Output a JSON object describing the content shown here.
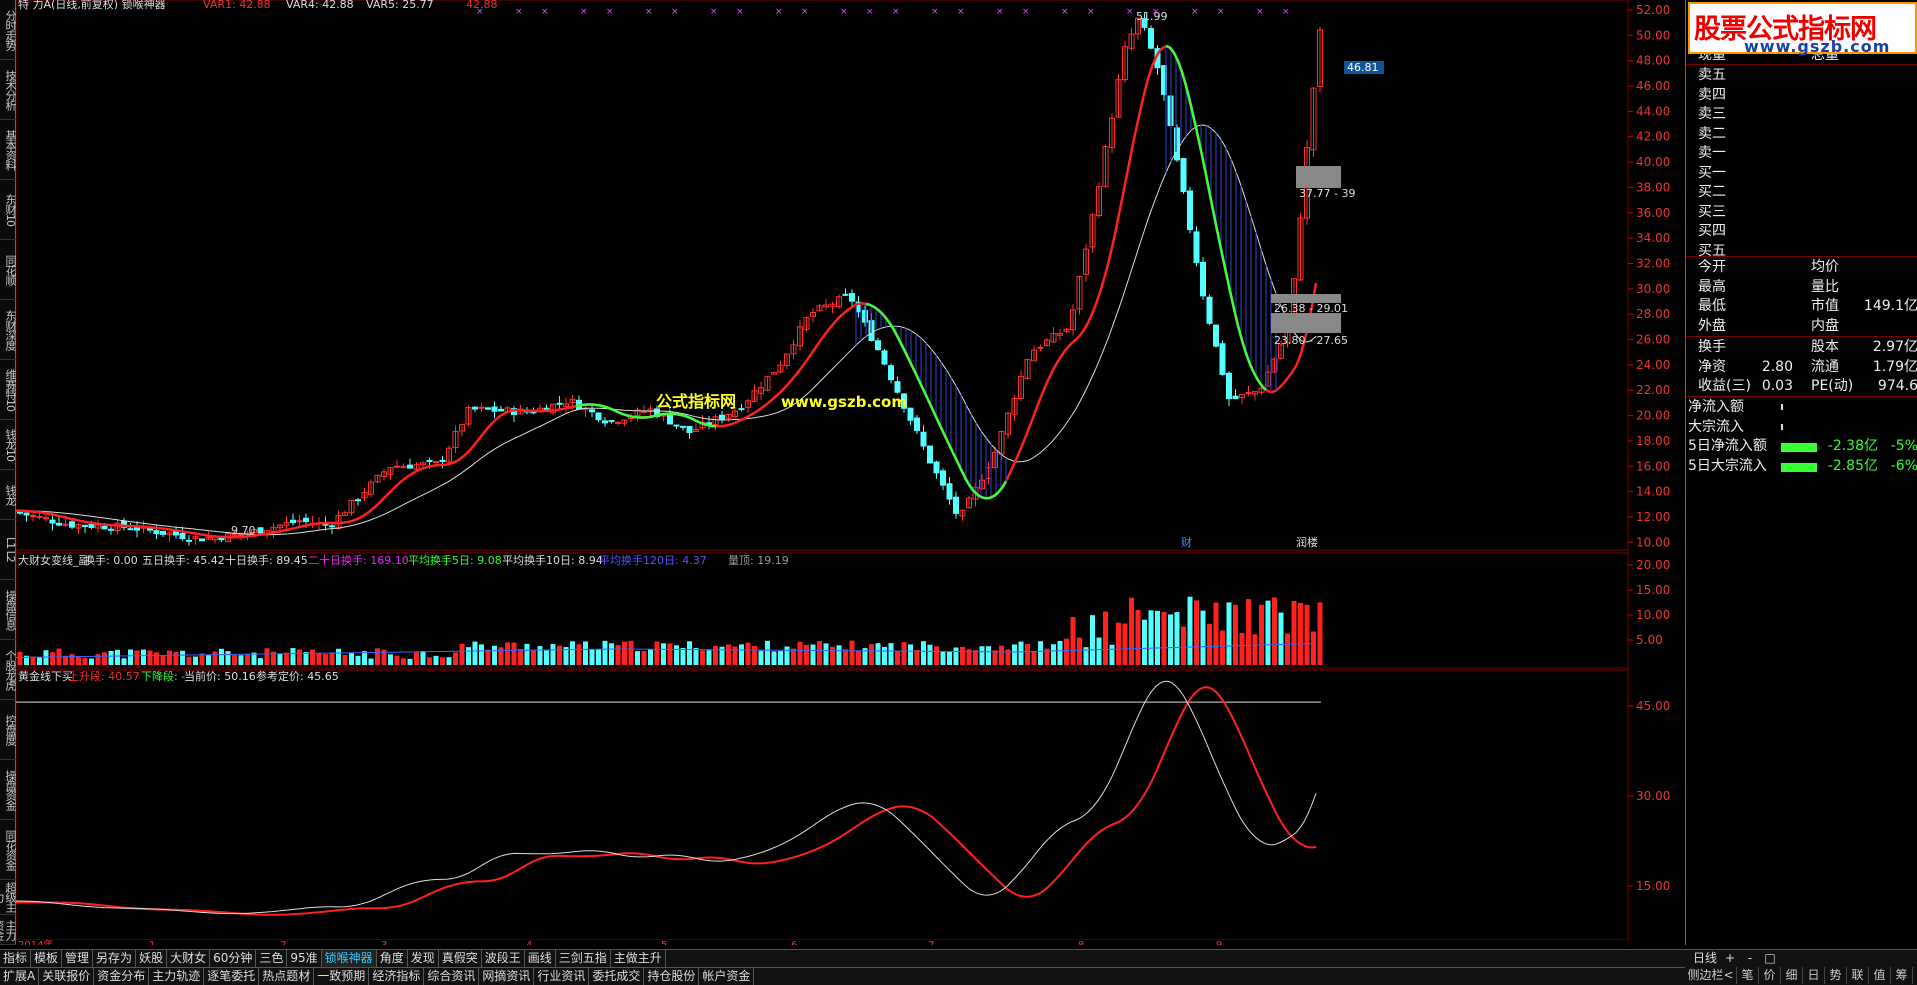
{
  "sidebar": {
    "tabs": [
      "分时走势",
      "技术分析",
      "基本资料",
      "东财10",
      "同花顺",
      "东财深度",
      "维赛特10",
      "钱龙10",
      "钱龙",
      "L1 L2",
      "操盘信息",
      "个股龙虎",
      "控盘度",
      "操盘资金",
      "同花资金",
      "超级主力",
      "主力资金"
    ]
  },
  "header": {
    "title": "特 力A(日线,前复权) 锁喉神器",
    "var1": "VAR1: 42.88",
    "var4": "VAR4: 42.88",
    "var5": "VAR5: 25.77",
    "var6": "42.88"
  },
  "price_labels": {
    "high": "51.99",
    "low": "9.70",
    "ref": "46.81",
    "box1": "37.77 - 39",
    "box2": "26.38 - 29.01",
    "box3": "23.80 - 27.65",
    "badge1": "财",
    "badge2": "润楼"
  },
  "price_axis": [
    "52.00",
    "50.00",
    "48.00",
    "46.00",
    "44.00",
    "42.00",
    "40.00",
    "38.00",
    "36.00",
    "34.00",
    "32.00",
    "30.00",
    "28.00",
    "26.00",
    "24.00",
    "22.00",
    "20.00",
    "18.00",
    "16.00",
    "14.00",
    "12.00",
    "10.00"
  ],
  "watermark": {
    "cn": "公式指标网",
    "url": "www.gszb.com"
  },
  "vol_header": {
    "name": "大财女变线_副",
    "f1": "换手: 0.00",
    "f2": "五日换手: 45.42",
    "f3": "十日换手: 89.45",
    "f4": "二十日换手: 169.10",
    "f5": "平均换手5日: 9.08",
    "f6": "平均换手10日: 8.94",
    "f7": "平均换手120日: 4.37",
    "f8": "量顶: 19.19"
  },
  "vol_axis": [
    "20.00",
    "15.00",
    "10.00",
    "5.00"
  ],
  "gold_header": {
    "name": "黄金线下买",
    "up": "上升段: 40.57",
    "down": "下降段: -",
    "cur": "当前价: 50.16",
    "ref": "参考定价: 45.65"
  },
  "gold_axis": [
    "45.00",
    "30.00",
    "15.00"
  ],
  "time_axis": {
    "year": "2014年",
    "months": [
      "2",
      "3",
      "4",
      "5",
      "6",
      "7",
      "8",
      "9"
    ],
    "extra": "1"
  },
  "logo": {
    "line1": "股票公式指标网",
    "line2": "www.gszb.com"
  },
  "right_panel": {
    "top": [
      "现量",
      "总量"
    ],
    "orders": [
      "卖五",
      "卖四",
      "卖三",
      "卖二",
      "卖一",
      "买一",
      "买二",
      "买三",
      "买四",
      "买五"
    ],
    "stats": [
      [
        "今开",
        "",
        "均价",
        ""
      ],
      [
        "最高",
        "",
        "量比",
        ""
      ],
      [
        "最低",
        "",
        "市值",
        "149.1亿"
      ],
      [
        "外盘",
        "",
        "内盘",
        ""
      ]
    ],
    "stats2": [
      [
        "换手",
        "",
        "股本",
        "2.97亿"
      ],
      [
        "净资",
        "2.80",
        "流通",
        "1.79亿"
      ],
      [
        "收益(三)",
        "0.03",
        "PE(动)",
        "974.6"
      ]
    ],
    "flow": [
      [
        "净流入额",
        "",
        ""
      ],
      [
        "大宗流入",
        "",
        ""
      ],
      [
        "5日净流入额",
        "-2.38亿",
        "-5%"
      ],
      [
        "5日大宗流入",
        "-2.85亿",
        "-6%"
      ]
    ]
  },
  "bottom_tabs1": [
    "指标",
    "模板",
    "管理",
    "另存为",
    "妖股",
    "大财女",
    "60分钟",
    "三色",
    "95准",
    "锁喉神器",
    "角度",
    "发现",
    "真假突",
    "波段王",
    "画线",
    "三剑五指",
    "主做主升"
  ],
  "bottom_tabs2": [
    "扩展A",
    "关联报价",
    "资金分布",
    "主力轨迹",
    "逐笔委托",
    "热点题材",
    "一致预期",
    "经济指标",
    "综合资讯",
    "网摘资讯",
    "行业资讯",
    "委托成交",
    "持仓股份",
    "帐户资金"
  ],
  "bottom_right": {
    "period": "日线",
    "row2": [
      "侧边栏<",
      "笔",
      "价",
      "细",
      "日",
      "势",
      "联",
      "值",
      "筹"
    ],
    "nav": [
      "+",
      "-",
      "□"
    ]
  },
  "chart_data": {
    "type": "candlestick",
    "title": "特 力A(日线,前复权)",
    "ylim": [
      9,
      52
    ],
    "high": 51.99,
    "low": 9.7,
    "moving_average_last": 46.81
  }
}
